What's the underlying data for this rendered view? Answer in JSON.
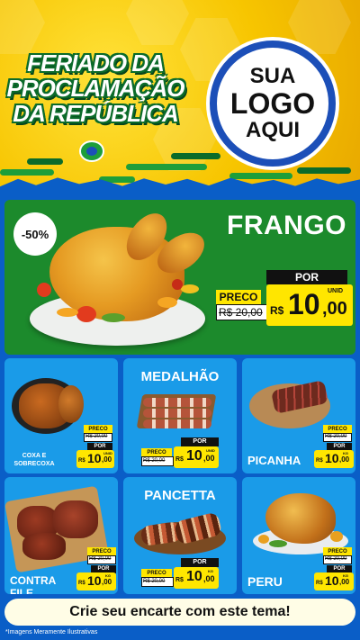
{
  "header": {
    "title_lines": [
      "FERIADO DA",
      "PROCLAMAÇÃO",
      "DA REPÚBLICA"
    ],
    "logo_lines": [
      "SUA",
      "LOGO",
      "AQUI"
    ]
  },
  "featured": {
    "name": "FRANGO",
    "discount": "-50%",
    "preco_label": "PRECO",
    "por_label": "POR",
    "old_price": "R$ 20,00",
    "currency": "R$",
    "price_whole": "10",
    "price_cents": ",00",
    "unit": "UNID"
  },
  "products": [
    {
      "name_lines": [
        "COXA E",
        "SOBRECOXA"
      ],
      "preco_label": "PRECO",
      "por_label": "POR",
      "old_price": "R$ 20,00",
      "currency": "R$",
      "price_whole": "10",
      "price_cents": ",00",
      "unit": "UNID"
    },
    {
      "name_lines": [
        "MEDALHÃO"
      ],
      "preco_label": "PRECO",
      "por_label": "POR",
      "old_price": "R$ 20,00",
      "currency": "R$",
      "price_whole": "10",
      "price_cents": ",00",
      "unit": "UNID"
    },
    {
      "name_lines": [
        "PICANHA"
      ],
      "preco_label": "PRECO",
      "por_label": "POR",
      "old_price": "R$ 20,00",
      "currency": "R$",
      "price_whole": "10",
      "price_cents": ",00",
      "unit": "KG"
    },
    {
      "name_lines": [
        "CONTRA FILE"
      ],
      "preco_label": "PRECO",
      "por_label": "POR",
      "old_price": "R$ 20,00",
      "currency": "R$",
      "price_whole": "10",
      "price_cents": ",00",
      "unit": "KG"
    },
    {
      "name_lines": [
        "PANCETTA"
      ],
      "preco_label": "PRECO",
      "por_label": "POR",
      "old_price": "R$ 20,00",
      "currency": "R$",
      "price_whole": "10",
      "price_cents": ",00",
      "unit": "KG"
    },
    {
      "name_lines": [
        "PERU"
      ],
      "preco_label": "PRECO",
      "por_label": "POR",
      "old_price": "R$ 20,00",
      "currency": "R$",
      "price_whole": "10",
      "price_cents": ",00",
      "unit": "KG"
    }
  ],
  "footer": {
    "cta": "Crie seu encarte com este tema!",
    "disclaimer": "*Imagens Meramente Ilustrativas"
  },
  "colors": {
    "yellow": "#f7c500",
    "green": "#1c8a2c",
    "blue": "#0a5ec7",
    "card_blue": "#1a9be8",
    "price_yellow": "#ffe600"
  },
  "icons": [
    "brazil-flag-badge-icon"
  ]
}
